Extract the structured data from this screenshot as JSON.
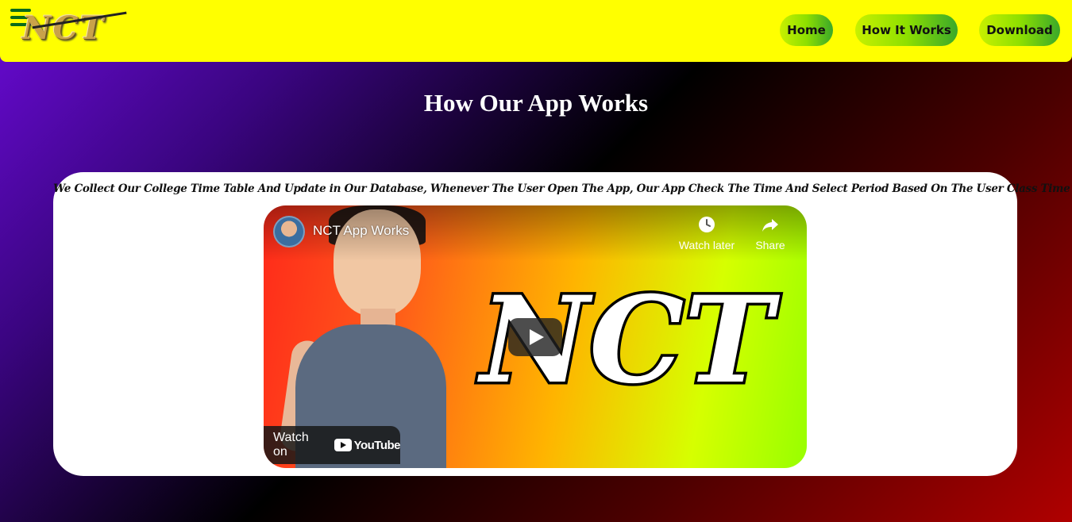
{
  "navbar": {
    "logo_text": "NCT",
    "menu_icon": "hamburger-menu-icon",
    "links": [
      "Home",
      "How It Works",
      "Download"
    ],
    "background_color": "#ffff00"
  },
  "main": {
    "title": "How Our App Works",
    "description": "We Collect Our College Time Table And Update in Our Database, Whenever The User Open The App, Our App Check The Time And Select Period Based On The User Class Time Table.."
  },
  "video": {
    "title": "NCT App Works",
    "thumbnail_text": "NCT",
    "watch_later_label": "Watch later",
    "share_label": "Share",
    "watch_on_label": "Watch on",
    "youtube_label": "YouTube",
    "icons": [
      "clock-icon",
      "share-arrow-icon",
      "play-icon",
      "youtube-logo-icon"
    ]
  }
}
